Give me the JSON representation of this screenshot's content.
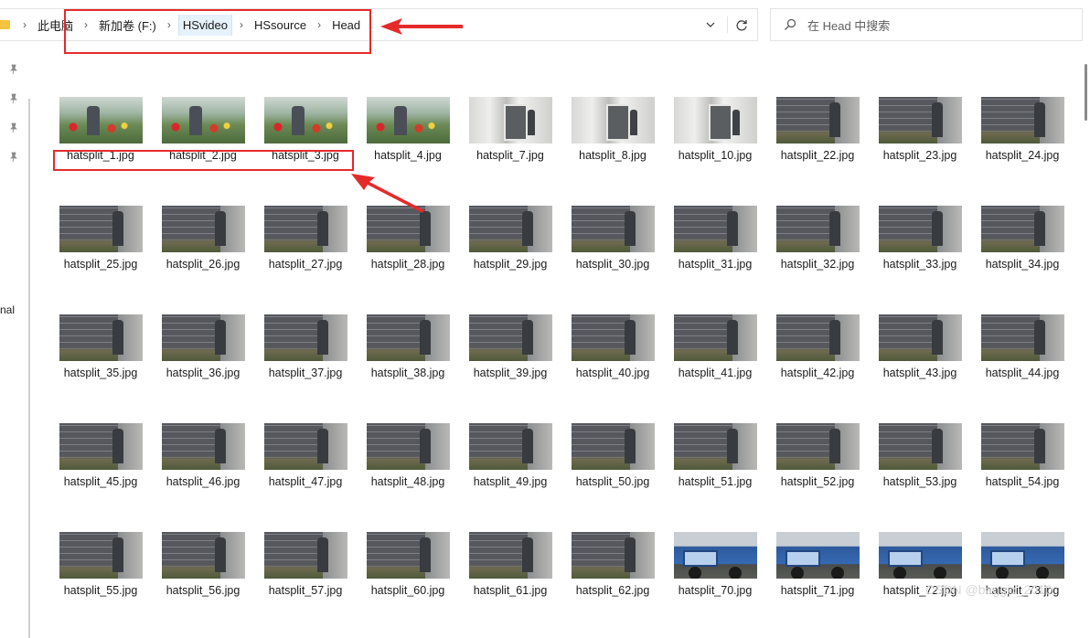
{
  "breadcrumb": {
    "items": [
      "此电脑",
      "新加卷 (F:)",
      "HSvideo",
      "HSsource",
      "Head"
    ]
  },
  "search": {
    "placeholder": "在 Head 中搜索"
  },
  "sidebar": {
    "label": "nal"
  },
  "files": [
    {
      "name": "hatsplit_1.jpg",
      "thumb": "garden"
    },
    {
      "name": "hatsplit_2.jpg",
      "thumb": "garden"
    },
    {
      "name": "hatsplit_3.jpg",
      "thumb": "garden"
    },
    {
      "name": "hatsplit_4.jpg",
      "thumb": "garden"
    },
    {
      "name": "hatsplit_7.jpg",
      "thumb": "room"
    },
    {
      "name": "hatsplit_8.jpg",
      "thumb": "room"
    },
    {
      "name": "hatsplit_10.jpg",
      "thumb": "room"
    },
    {
      "name": "hatsplit_22.jpg",
      "thumb": "wall"
    },
    {
      "name": "hatsplit_23.jpg",
      "thumb": "wall"
    },
    {
      "name": "hatsplit_24.jpg",
      "thumb": "wall"
    },
    {
      "name": "hatsplit_25.jpg",
      "thumb": "wall"
    },
    {
      "name": "hatsplit_26.jpg",
      "thumb": "wall"
    },
    {
      "name": "hatsplit_27.jpg",
      "thumb": "wall"
    },
    {
      "name": "hatsplit_28.jpg",
      "thumb": "wall"
    },
    {
      "name": "hatsplit_29.jpg",
      "thumb": "wall"
    },
    {
      "name": "hatsplit_30.jpg",
      "thumb": "wall"
    },
    {
      "name": "hatsplit_31.jpg",
      "thumb": "wall"
    },
    {
      "name": "hatsplit_32.jpg",
      "thumb": "wall"
    },
    {
      "name": "hatsplit_33.jpg",
      "thumb": "wall"
    },
    {
      "name": "hatsplit_34.jpg",
      "thumb": "wall"
    },
    {
      "name": "hatsplit_35.jpg",
      "thumb": "wall"
    },
    {
      "name": "hatsplit_36.jpg",
      "thumb": "wall"
    },
    {
      "name": "hatsplit_37.jpg",
      "thumb": "wall"
    },
    {
      "name": "hatsplit_38.jpg",
      "thumb": "wall"
    },
    {
      "name": "hatsplit_39.jpg",
      "thumb": "wall"
    },
    {
      "name": "hatsplit_40.jpg",
      "thumb": "wall"
    },
    {
      "name": "hatsplit_41.jpg",
      "thumb": "wall"
    },
    {
      "name": "hatsplit_42.jpg",
      "thumb": "wall"
    },
    {
      "name": "hatsplit_43.jpg",
      "thumb": "wall"
    },
    {
      "name": "hatsplit_44.jpg",
      "thumb": "wall"
    },
    {
      "name": "hatsplit_45.jpg",
      "thumb": "wall"
    },
    {
      "name": "hatsplit_46.jpg",
      "thumb": "wall"
    },
    {
      "name": "hatsplit_47.jpg",
      "thumb": "wall"
    },
    {
      "name": "hatsplit_48.jpg",
      "thumb": "wall"
    },
    {
      "name": "hatsplit_49.jpg",
      "thumb": "wall"
    },
    {
      "name": "hatsplit_50.jpg",
      "thumb": "wall"
    },
    {
      "name": "hatsplit_51.jpg",
      "thumb": "wall"
    },
    {
      "name": "hatsplit_52.jpg",
      "thumb": "wall"
    },
    {
      "name": "hatsplit_53.jpg",
      "thumb": "wall"
    },
    {
      "name": "hatsplit_54.jpg",
      "thumb": "wall"
    },
    {
      "name": "hatsplit_55.jpg",
      "thumb": "wall"
    },
    {
      "name": "hatsplit_56.jpg",
      "thumb": "wall"
    },
    {
      "name": "hatsplit_57.jpg",
      "thumb": "wall"
    },
    {
      "name": "hatsplit_60.jpg",
      "thumb": "wall"
    },
    {
      "name": "hatsplit_61.jpg",
      "thumb": "wall"
    },
    {
      "name": "hatsplit_62.jpg",
      "thumb": "wall"
    },
    {
      "name": "hatsplit_70.jpg",
      "thumb": "truck"
    },
    {
      "name": "hatsplit_71.jpg",
      "thumb": "truck"
    },
    {
      "name": "hatsplit_72.jpg",
      "thumb": "truck"
    },
    {
      "name": "hatsplit_73.jpg",
      "thumb": "truck"
    }
  ],
  "watermark": "CSDN @baggio_2010",
  "colors": {
    "annotation": "#e52a2a",
    "selected_crumb": "#e5f1fb",
    "folder": "#f5c342"
  }
}
